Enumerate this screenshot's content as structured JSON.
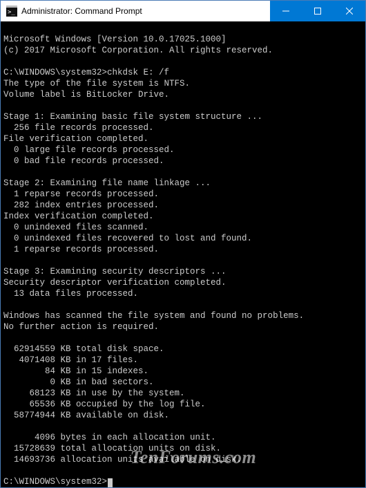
{
  "titlebar": {
    "title": "Administrator: Command Prompt"
  },
  "session": {
    "header": [
      "Microsoft Windows [Version 10.0.17025.1000]",
      "(c) 2017 Microsoft Corporation. All rights reserved.",
      ""
    ],
    "prompt1": "C:\\WINDOWS\\system32>",
    "command1": "chkdsk E: /f",
    "output": [
      "The type of the file system is NTFS.",
      "Volume label is BitLocker Drive.",
      "",
      "Stage 1: Examining basic file system structure ...",
      "  256 file records processed.",
      "File verification completed.",
      "  0 large file records processed.",
      "  0 bad file records processed.",
      "",
      "Stage 2: Examining file name linkage ...",
      "  1 reparse records processed.",
      "  282 index entries processed.",
      "Index verification completed.",
      "  0 unindexed files scanned.",
      "  0 unindexed files recovered to lost and found.",
      "  1 reparse records processed.",
      "",
      "Stage 3: Examining security descriptors ...",
      "Security descriptor verification completed.",
      "  13 data files processed.",
      "",
      "Windows has scanned the file system and found no problems.",
      "No further action is required.",
      "",
      "  62914559 KB total disk space.",
      "   4071408 KB in 17 files.",
      "        84 KB in 15 indexes.",
      "         0 KB in bad sectors.",
      "     68123 KB in use by the system.",
      "     65536 KB occupied by the log file.",
      "  58774944 KB available on disk.",
      "",
      "      4096 bytes in each allocation unit.",
      "  15728639 total allocation units on disk.",
      "  14693736 allocation units available on disk.",
      ""
    ],
    "prompt2": "C:\\WINDOWS\\system32>"
  },
  "watermark": "TenForums.com"
}
